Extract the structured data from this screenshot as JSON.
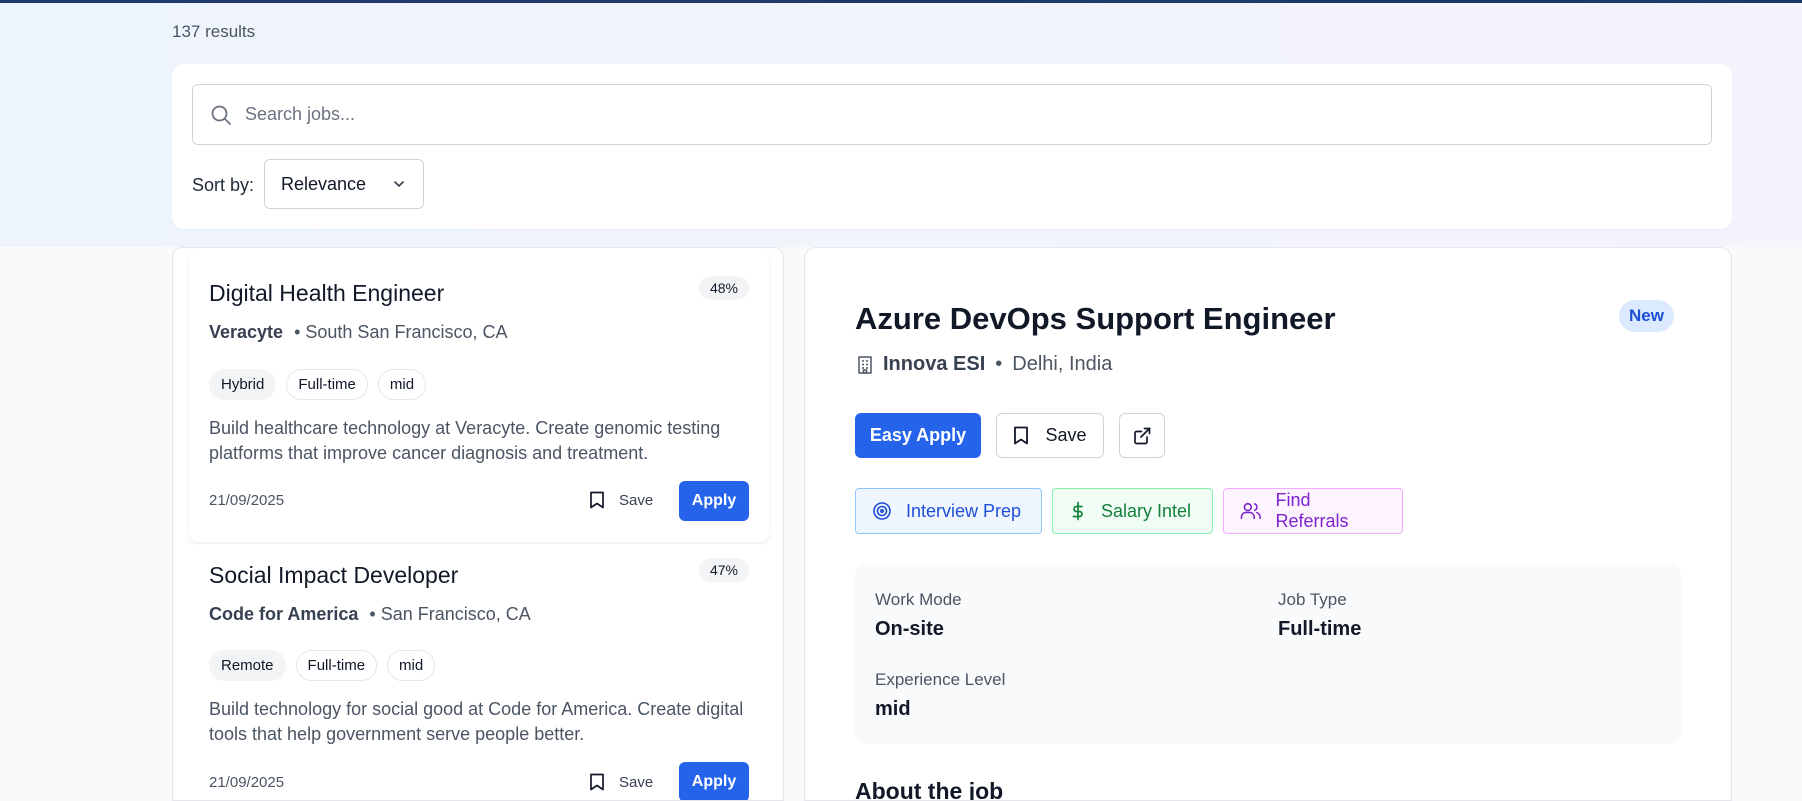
{
  "results_count": "137 results",
  "search": {
    "placeholder": "Search jobs..."
  },
  "sort": {
    "label": "Sort by:",
    "value": "Relevance"
  },
  "jobs": [
    {
      "title": "Digital Health Engineer",
      "match": "48%",
      "company": "Veracyte",
      "location": "• South San Francisco, CA",
      "tags": [
        "Hybrid",
        "Full-time",
        "mid"
      ],
      "description": "Build healthcare technology at Veracyte. Create genomic testing platforms that improve cancer diagnosis and treatment.",
      "date": "21/09/2025",
      "save_label": "Save",
      "apply_label": "Apply"
    },
    {
      "title": "Social Impact Developer",
      "match": "47%",
      "company": "Code for America",
      "location": "• San Francisco, CA",
      "tags": [
        "Remote",
        "Full-time",
        "mid"
      ],
      "description": "Build technology for social good at Code for America. Create digital tools that help government serve people better.",
      "date": "21/09/2025",
      "save_label": "Save",
      "apply_label": "Apply"
    }
  ],
  "detail": {
    "title": "Azure DevOps Support Engineer",
    "badge": "New",
    "company": "Innova ESI",
    "separator": "•",
    "location": "Delhi, India",
    "easy_apply_label": "Easy Apply",
    "save_label": "Save",
    "tools": [
      "Interview Prep",
      "Salary Intel",
      "Find Referrals"
    ],
    "facts": {
      "work_mode_label": "Work Mode",
      "work_mode": "On-site",
      "job_type_label": "Job Type",
      "job_type": "Full-time",
      "experience_label": "Experience Level",
      "experience": "mid"
    },
    "about_heading": "About the job"
  },
  "colors": {
    "accent": "#2563eb",
    "top_bar": "#1e3a6b",
    "interview_prep": "#1d4ed8",
    "salary_intel": "#15803d",
    "find_referrals": "#7e22ce"
  },
  "icons": [
    "search-icon",
    "chevron-down-icon",
    "bookmark-icon",
    "building-icon",
    "external-link-icon",
    "target-icon",
    "dollar-icon",
    "users-icon"
  ]
}
